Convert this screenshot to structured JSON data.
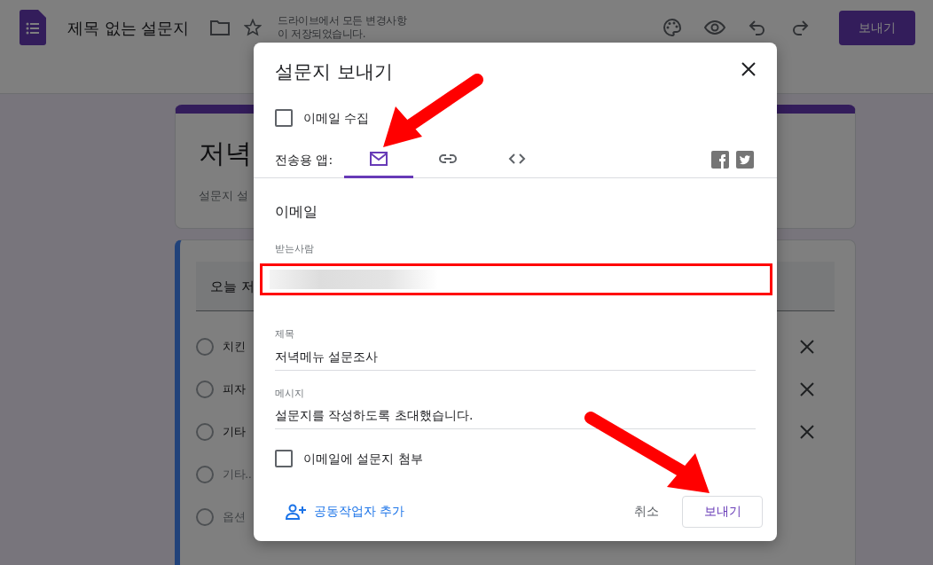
{
  "header": {
    "title": "제목 없는 설문지",
    "save_status": "드라이브에서 모든 변경사항\n이 저장되었습니다.",
    "send_button": "보내기"
  },
  "form": {
    "title": "저녁",
    "description": "설문지 설",
    "question": "오늘 저",
    "options": [
      {
        "kind": "option",
        "label": "치킨",
        "selected": false
      },
      {
        "kind": "option",
        "label": "피자",
        "selected": false
      },
      {
        "kind": "option",
        "label": "기타",
        "selected": false
      },
      {
        "kind": "other",
        "label": "기타..",
        "selected": false
      },
      {
        "kind": "add",
        "label": "옵션 ",
        "selected": false
      }
    ]
  },
  "dialog": {
    "title": "설문지 보내기",
    "collect_email": {
      "label": "이메일 수집",
      "checked": false
    },
    "send_via": {
      "label": "전송용 앱:",
      "tabs": [
        {
          "kind": "email",
          "selected": true
        },
        {
          "kind": "link",
          "selected": false
        },
        {
          "kind": "embed",
          "selected": false
        }
      ]
    },
    "section_title": "이메일",
    "recipients": {
      "label": "받는사람"
    },
    "subject": {
      "label": "제목",
      "value": "저녁메뉴 설문조사"
    },
    "message": {
      "label": "메시지",
      "value": "설문지를 작성하도록 초대했습니다."
    },
    "attach": {
      "label": "이메일에 설문지 첨부",
      "checked": false
    },
    "add_collaborators": "공동작업자 추가",
    "cancel": "취소",
    "send": "보내기"
  }
}
